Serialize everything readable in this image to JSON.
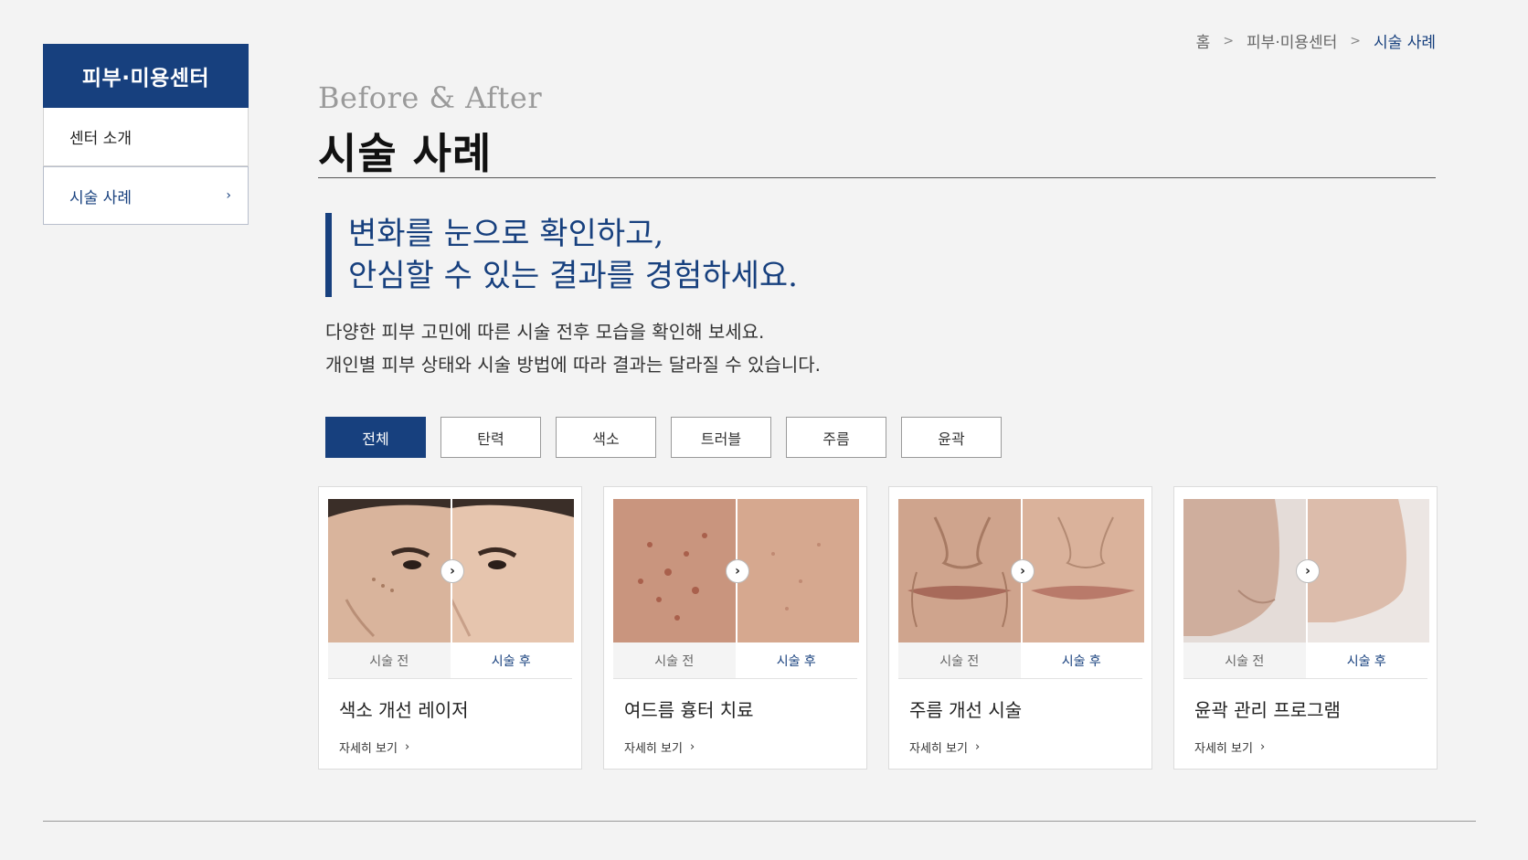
{
  "sidebar": {
    "header": "피부·미용센터",
    "items": [
      {
        "label": "센터 소개",
        "active": false
      },
      {
        "label": "시술 사례",
        "active": true,
        "chevron": "›"
      }
    ]
  },
  "breadcrumb": {
    "items": [
      "홈",
      "피부·미용센터",
      "시술 사례"
    ],
    "separator": ">"
  },
  "title": {
    "en": "Before & After",
    "ko": "시술 사례"
  },
  "headline": {
    "line1": "변화를 눈으로 확인하고,",
    "line2": "안심할 수 있는 결과를 경험하세요."
  },
  "description": {
    "line1": "다양한 피부 고민에 따른 시술 전후 모습을 확인해 보세요.",
    "line2": "개인별 피부 상태와 시술 방법에 따라 결과는 달라질 수 있습니다."
  },
  "filters": [
    {
      "label": "전체",
      "active": true
    },
    {
      "label": "탄력",
      "active": false
    },
    {
      "label": "색소",
      "active": false
    },
    {
      "label": "트러블",
      "active": false
    },
    {
      "label": "주름",
      "active": false
    },
    {
      "label": "윤곽",
      "active": false
    }
  ],
  "cards": [
    {
      "before_label": "시술 전",
      "after_label": "시술 후",
      "title": "색소 개선 레이저",
      "link": "자세히 보기",
      "arrow": "›",
      "link_chevron": "›",
      "image": "face-pigmentation"
    },
    {
      "before_label": "시술 전",
      "after_label": "시술 후",
      "title": "여드름 흉터 치료",
      "link": "자세히 보기",
      "arrow": "›",
      "link_chevron": "›",
      "image": "cheek-acne-scar"
    },
    {
      "before_label": "시술 전",
      "after_label": "시술 후",
      "title": "주름 개선 시술",
      "link": "자세히 보기",
      "arrow": "›",
      "link_chevron": "›",
      "image": "mouth-wrinkle"
    },
    {
      "before_label": "시술 전",
      "after_label": "시술 후",
      "title": "윤곽 관리 프로그램",
      "link": "자세히 보기",
      "arrow": "›",
      "link_chevron": "›",
      "image": "jawline-contour"
    }
  ],
  "colors": {
    "primary": "#17407e",
    "background": "#f3f3f3"
  }
}
